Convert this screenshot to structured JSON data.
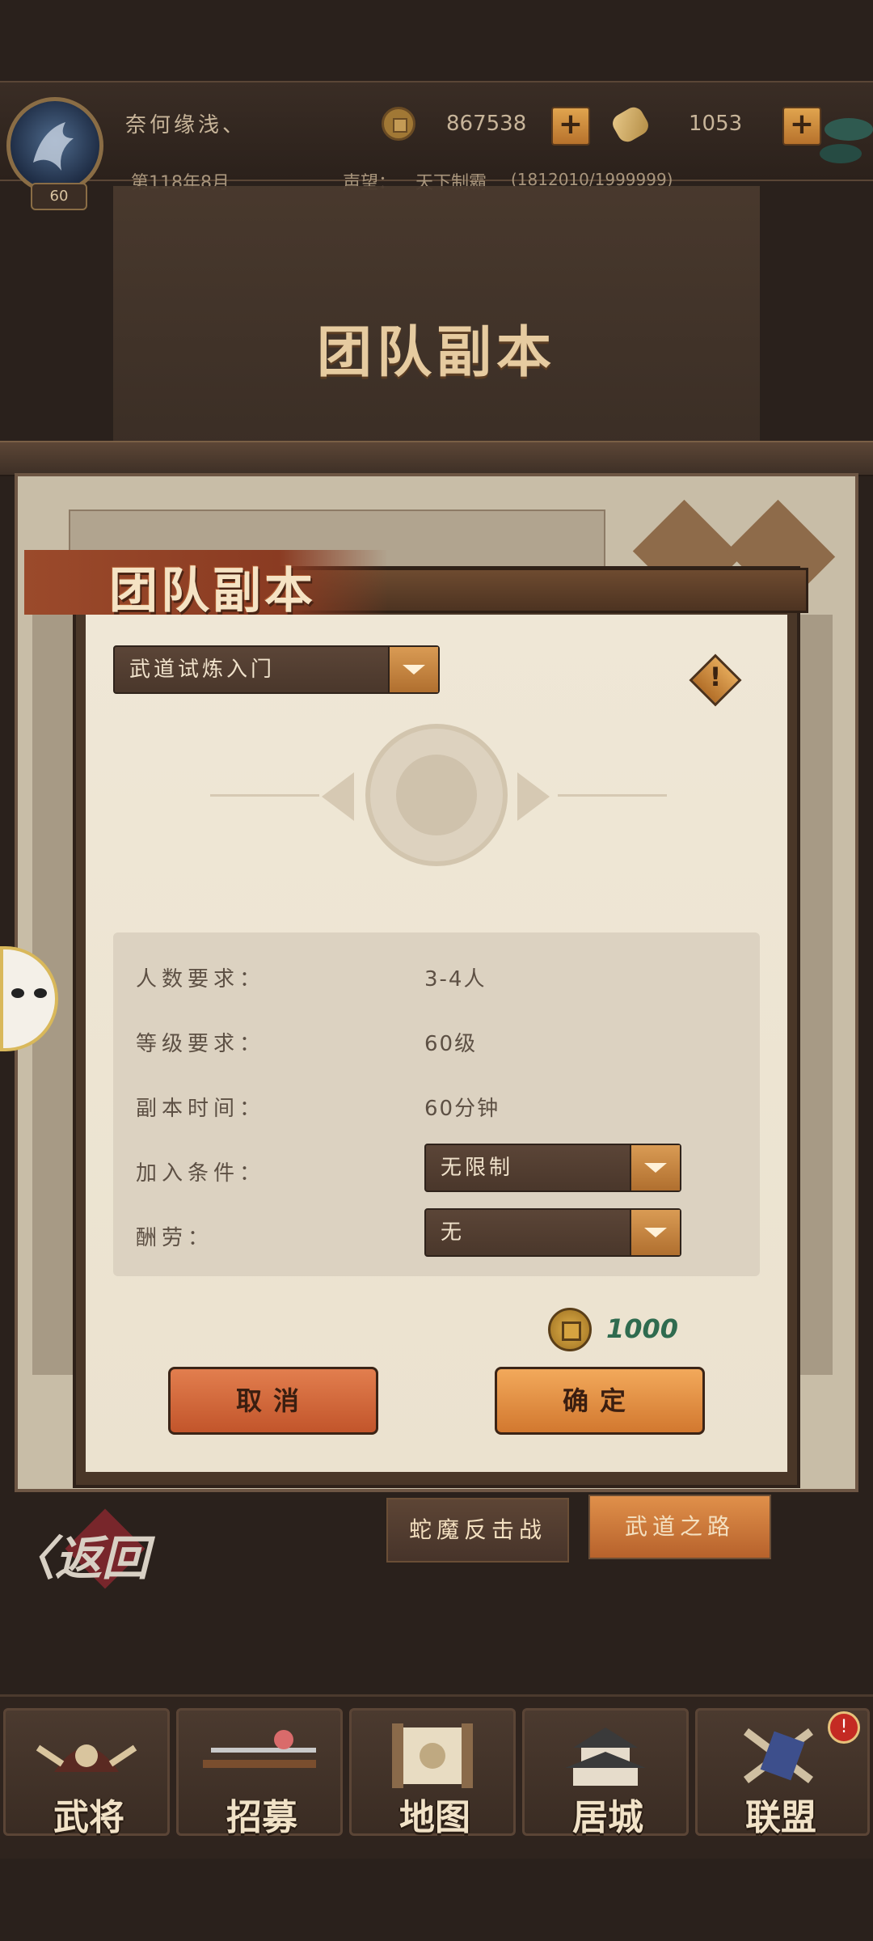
{
  "player": {
    "name": "奈何缘浅、",
    "level": "60",
    "date": "第118年8月",
    "reputation_label": "声望：",
    "reputation_title": "天下制霸",
    "reputation_progress": "(1812010/1999999)"
  },
  "currency": {
    "coins": "867538",
    "gold": "1053"
  },
  "banner": {
    "title": "团队副本"
  },
  "dialog": {
    "title": "团队副本",
    "dungeon_select": "武道试炼入门",
    "info": [
      {
        "label": "人数要求：",
        "value": "3-4人"
      },
      {
        "label": "等级要求：",
        "value": "60级"
      },
      {
        "label": "副本时间：",
        "value": "60分钟"
      },
      {
        "label": "加入条件：",
        "value": "无限制"
      },
      {
        "label": "酬劳：",
        "value": "无"
      }
    ],
    "cost": "1000",
    "cancel_label": "取消",
    "confirm_label": "确定"
  },
  "tabs": [
    "蛇魔反击战",
    "武道之路"
  ],
  "back_label": "返回",
  "bottom_nav": [
    "武将",
    "招募",
    "地图",
    "居城",
    "联盟"
  ],
  "colors": {
    "accent": "#d2782f",
    "cancel": "#c2552b",
    "cost_text": "#2f6b4f"
  }
}
